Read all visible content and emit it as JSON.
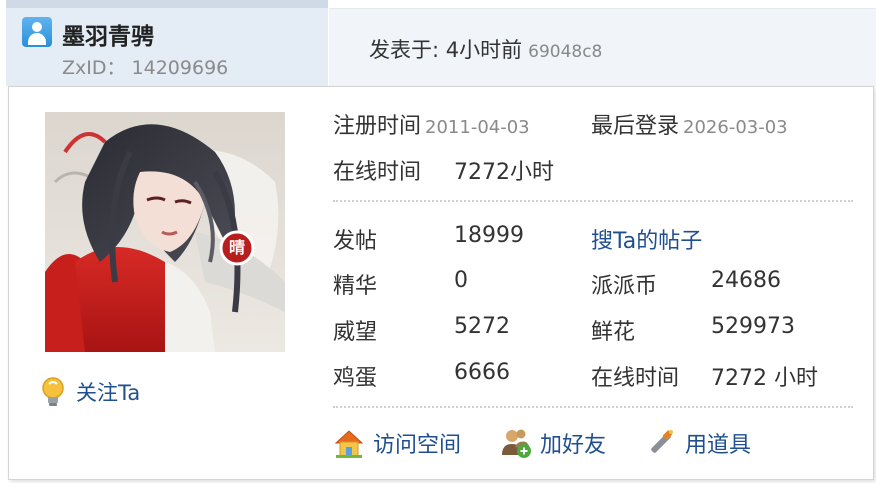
{
  "post_header": {
    "username": "墨羽青骋",
    "zxid_label": "ZxID：",
    "zxid_value": "14209696",
    "posted_label": "发表于: 4小时前",
    "post_hash": "69048c8"
  },
  "profile": {
    "registered_label": "注册时间",
    "registered_value": "2011-04-03",
    "last_login_label": "最后登录",
    "last_login_value": "2026-03-03",
    "online_label": "在线时间",
    "online_value": "7272小时",
    "stats": {
      "posts_label": "发帖",
      "posts_value": "18999",
      "search_posts_link": "搜Ta的帖子",
      "digest_label": "精华",
      "digest_value": "0",
      "coins_label": "派派币",
      "coins_value": "24686",
      "prestige_label": "威望",
      "prestige_value": "5272",
      "flowers_label": "鲜花",
      "flowers_value": "529973",
      "eggs_label": "鸡蛋",
      "eggs_value": "6666",
      "online_time_label": "在线时间",
      "online_time_value": "7272 小时"
    },
    "badge_char": "晴",
    "follow_label": "关注Ta",
    "actions": {
      "visit_space": "访问空间",
      "add_friend": "加好友",
      "use_item": "用道具"
    }
  },
  "colors": {
    "link": "#1f4f8f",
    "header_left_bg": "#e4ecf5",
    "header_right_bg": "#f1f5fa",
    "text": "#333333",
    "muted": "#8a8a8a"
  },
  "icons": [
    "user-avatar-icon",
    "lightbulb-icon",
    "home-icon",
    "add-friend-icon",
    "magic-wand-icon"
  ]
}
